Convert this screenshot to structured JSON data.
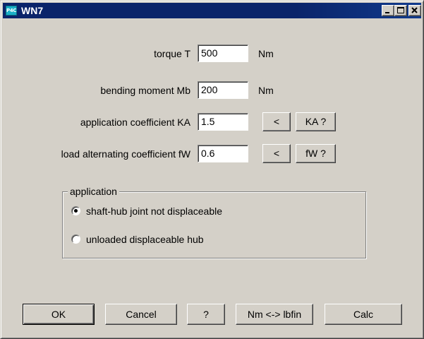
{
  "window": {
    "title": "WN7",
    "icon_text": "P4C",
    "controls": {
      "minimize": "minimize-icon",
      "maximize": "maximize-icon",
      "close": "close-icon"
    }
  },
  "fields": [
    {
      "label": "torque T",
      "value": "500",
      "unit": "Nm"
    },
    {
      "label": "bending moment Mb",
      "value": "200",
      "unit": "Nm"
    },
    {
      "label": "application coefficient KA",
      "value": "1.5",
      "picker": "<",
      "help": "KA  ?"
    },
    {
      "label": "load alternating coefficient fW",
      "value": "0.6",
      "picker": "<",
      "help": "fW  ?"
    }
  ],
  "application": {
    "legend": "application",
    "options": [
      {
        "label": "shaft-hub joint not displaceable",
        "selected": true
      },
      {
        "label": "unloaded displaceable hub",
        "selected": false
      }
    ]
  },
  "buttons": {
    "ok": "OK",
    "cancel": "Cancel",
    "help": "?",
    "convert": "Nm <-> lbfin",
    "calc": "Calc"
  },
  "colors": {
    "titlebar": "#0a246a",
    "face": "#d4d0c8",
    "icon": "#1bb0c8"
  }
}
